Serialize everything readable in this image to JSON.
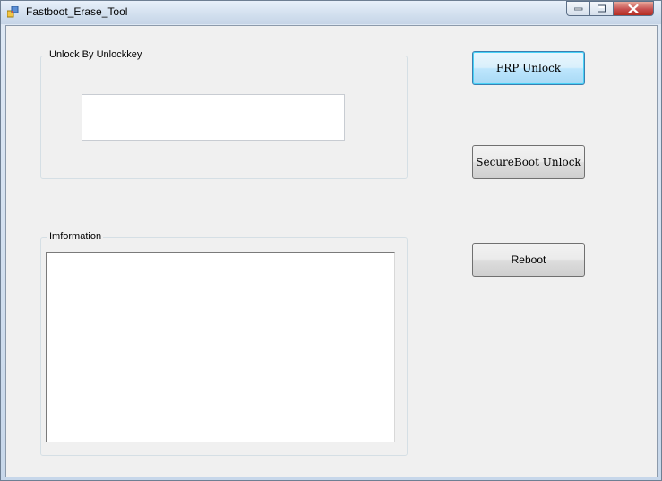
{
  "window": {
    "title": "Fastboot_Erase_Tool",
    "controls": {
      "minimize_icon": "minimize-icon",
      "maximize_icon": "maximize-icon",
      "close_icon": "close-icon"
    }
  },
  "unlock_group": {
    "label": "Unlock By Unlockkey",
    "unlockkey_value": ""
  },
  "info_group": {
    "label": "Imformation",
    "text": ""
  },
  "buttons": {
    "frp_unlock": "FRP Unlock",
    "secureboot_unlock": "SecureBoot Unlock",
    "reboot": "Reboot"
  },
  "colors": {
    "focus_button_border": "#3c7fb1",
    "close_button": "#c75050",
    "client_background": "#f0f0f0"
  }
}
